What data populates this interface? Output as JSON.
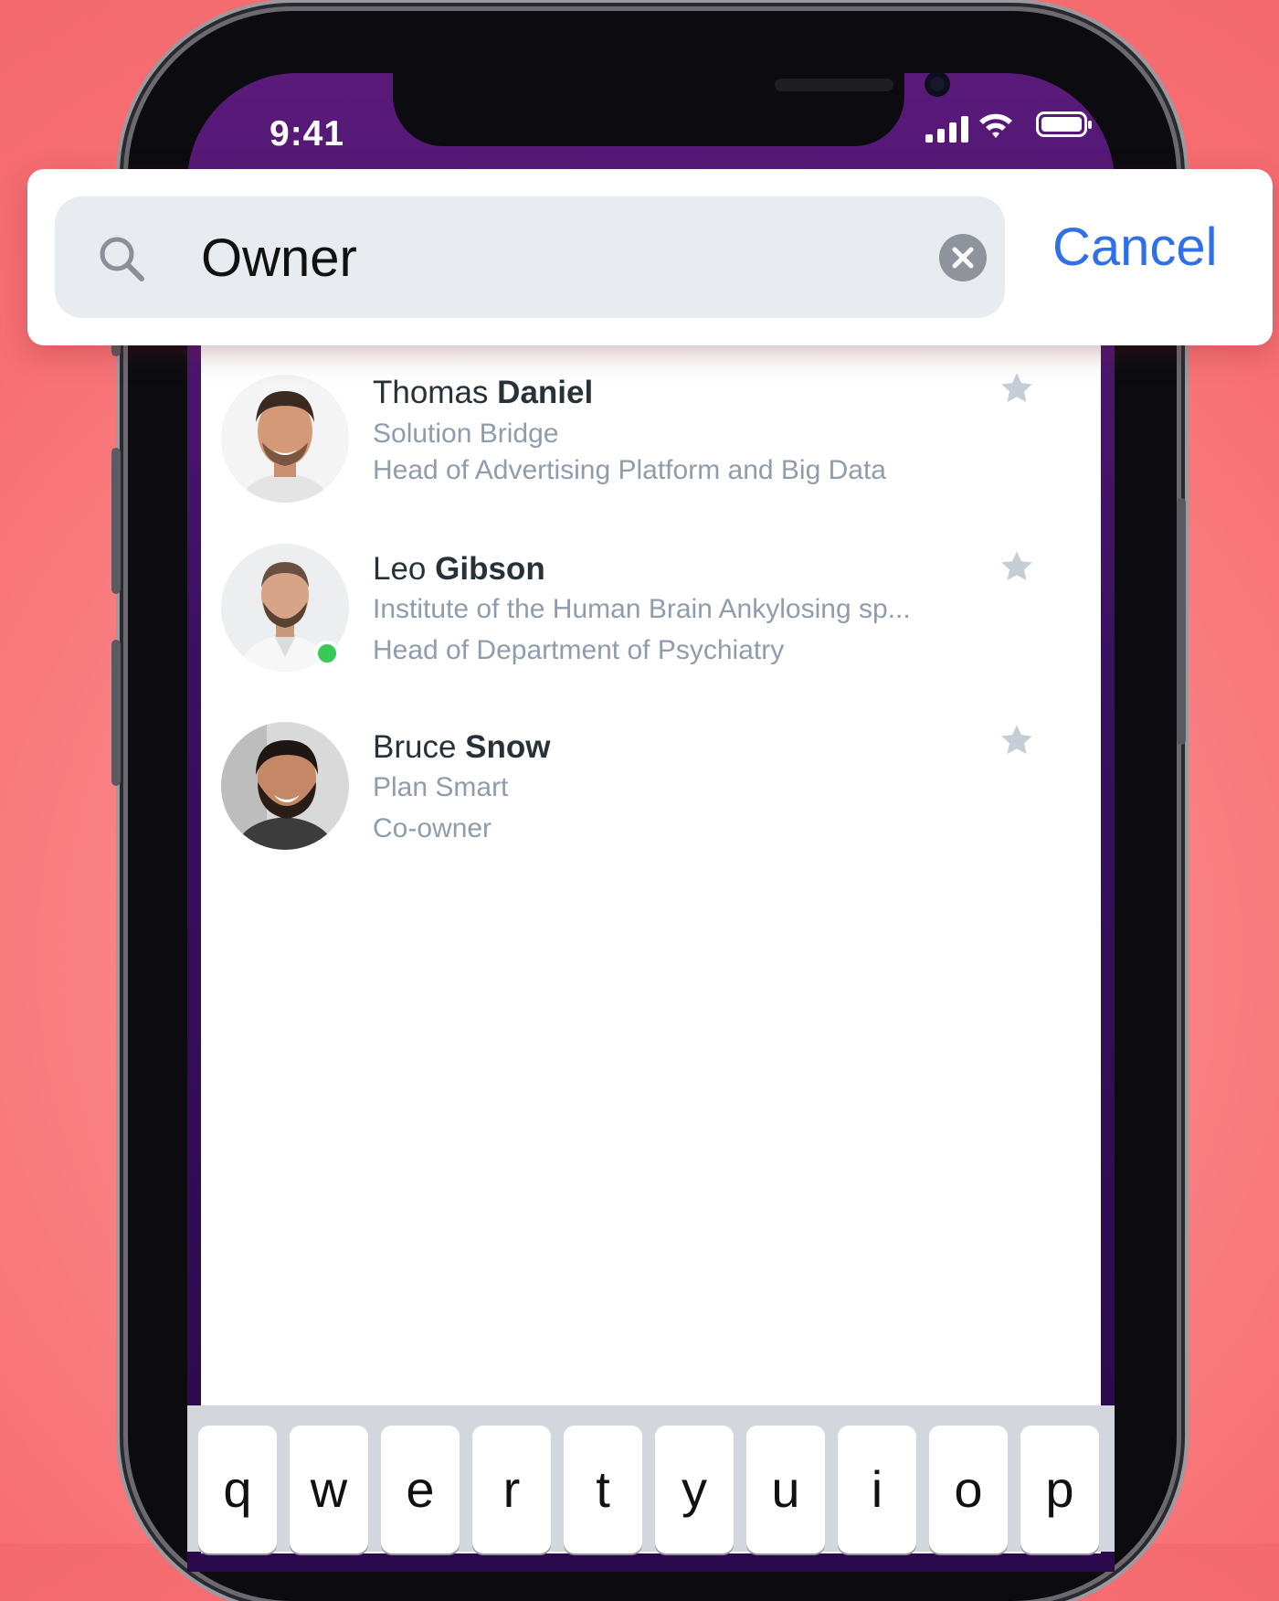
{
  "status_bar": {
    "time": "9:41"
  },
  "search": {
    "query": "Owner",
    "cancel_label": "Cancel"
  },
  "results": [
    {
      "first_name": "Thomas",
      "last_name": "Daniel",
      "company": "Solution Bridge",
      "role": "Head of Advertising Platform and Big Data",
      "online": false,
      "favorite_icon": "star-icon"
    },
    {
      "first_name": "Leo",
      "last_name": "Gibson",
      "company": "Institute of the Human Brain Ankylosing sp...",
      "role": "Head of Department of Psychiatry",
      "online": true,
      "favorite_icon": "star-icon"
    },
    {
      "first_name": "Bruce",
      "last_name": "Snow",
      "company": "Plan Smart",
      "role": "Co-owner",
      "online": false,
      "favorite_icon": "star-icon"
    }
  ],
  "keyboard": {
    "keys": [
      "q",
      "w",
      "e",
      "r",
      "t",
      "y",
      "u",
      "i",
      "o",
      "p"
    ]
  },
  "colors": {
    "background": "#f87e80",
    "accent": "#2f6fe8",
    "online": "#38c853",
    "secondary_text": "#8f9cad"
  }
}
